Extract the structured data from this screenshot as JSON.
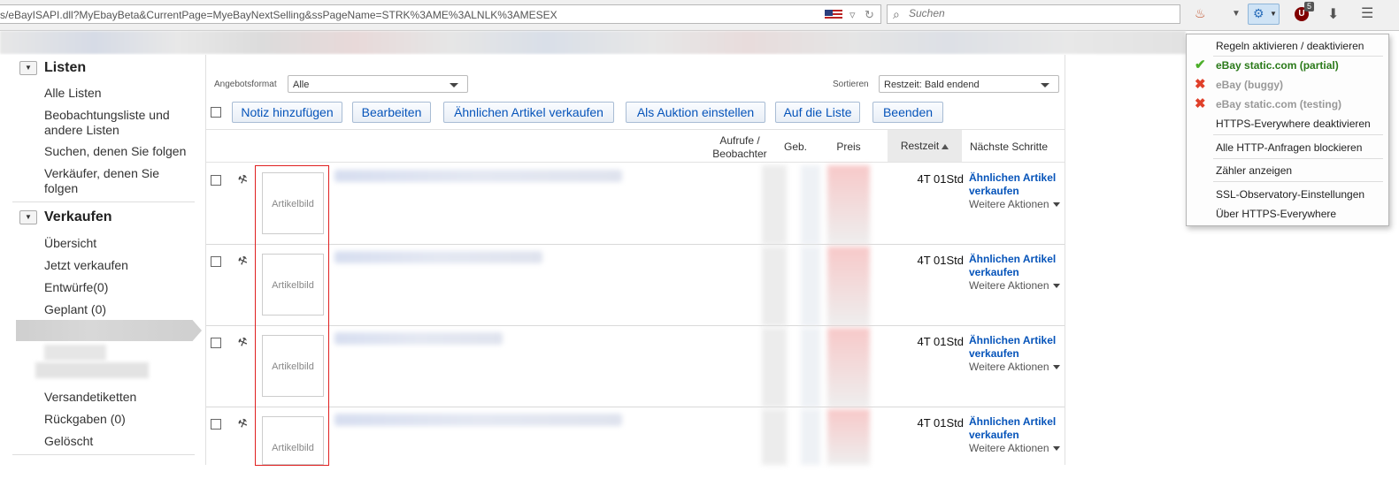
{
  "browser": {
    "url": "s/eBayISAPI.dll?MyEbayBeta&CurrentPage=MyeBayNextSelling&ssPageName=STRK%3AME%3ALNLK%3AMESEX",
    "search_placeholder": "Suchen",
    "ublock_count": "5"
  },
  "sidebar": {
    "listen_heading": "Listen",
    "listen_items": [
      "Alle Listen",
      "Beobachtungsliste und andere Listen",
      "Suchen, denen Sie folgen",
      "Verkäufer, denen Sie folgen"
    ],
    "verkaufen_heading": "Verkaufen",
    "verkaufen_items": [
      "Übersicht",
      "Jetzt verkaufen",
      "Entwürfe(0)",
      "Geplant (0)"
    ],
    "bottom_items": [
      "Versandetiketten",
      "Rückgaben (0)",
      "Gelöscht"
    ]
  },
  "filters": {
    "format_label": "Angebotsformat",
    "format_value": "Alle",
    "sort_label": "Sortieren",
    "sort_value": "Restzeit: Bald endend"
  },
  "actions": [
    "Notiz hinzufügen",
    "Bearbeiten",
    "Ähnlichen Artikel verkaufen",
    "Als Auktion einstellen",
    "Auf die Liste",
    "Beenden"
  ],
  "columns": {
    "views": "Aufrufe / Beobachter",
    "bids": "Geb.",
    "price": "Preis",
    "time_left": "Restzeit",
    "next_steps": "Nächste Schritte"
  },
  "rows": [
    {
      "image_label": "Artikelbild",
      "time_left": "4T 01Std",
      "next_action": "Ähnlichen Artikel verkaufen",
      "more": "Weitere Aktionen"
    },
    {
      "image_label": "Artikelbild",
      "time_left": "4T 01Std",
      "next_action": "Ähnlichen Artikel verkaufen",
      "more": "Weitere Aktionen"
    },
    {
      "image_label": "Artikelbild",
      "time_left": "4T 01Std",
      "next_action": "Ähnlichen Artikel verkaufen",
      "more": "Weitere Aktionen"
    },
    {
      "image_label": "Artikelbild",
      "time_left": "4T 01Std",
      "next_action": "Ähnlichen Artikel verkaufen",
      "more": "Weitere Aktionen"
    }
  ],
  "menu": {
    "items": [
      {
        "label": "Regeln aktivieren / deaktivieren",
        "state": "normal"
      },
      {
        "label": "eBay static.com (partial)",
        "state": "active",
        "icon": "check-icon"
      },
      {
        "label": "eBay (buggy)",
        "state": "disabled",
        "icon": "cross-icon"
      },
      {
        "label": "eBay static.com (testing)",
        "state": "disabled",
        "icon": "cross-icon"
      },
      {
        "label": "HTTPS-Everywhere deaktivieren",
        "state": "normal"
      },
      {
        "label": "Alle HTTP-Anfragen blockieren",
        "state": "normal"
      },
      {
        "label": "Zähler anzeigen",
        "state": "normal"
      },
      {
        "label": "SSL-Observatory-Einstellungen",
        "state": "normal"
      },
      {
        "label": "Über HTTPS-Everywhere",
        "state": "normal"
      }
    ]
  },
  "colors": {
    "link": "#0654ba",
    "active_rule": "#2b7a1a",
    "annotation": "#e02020"
  }
}
